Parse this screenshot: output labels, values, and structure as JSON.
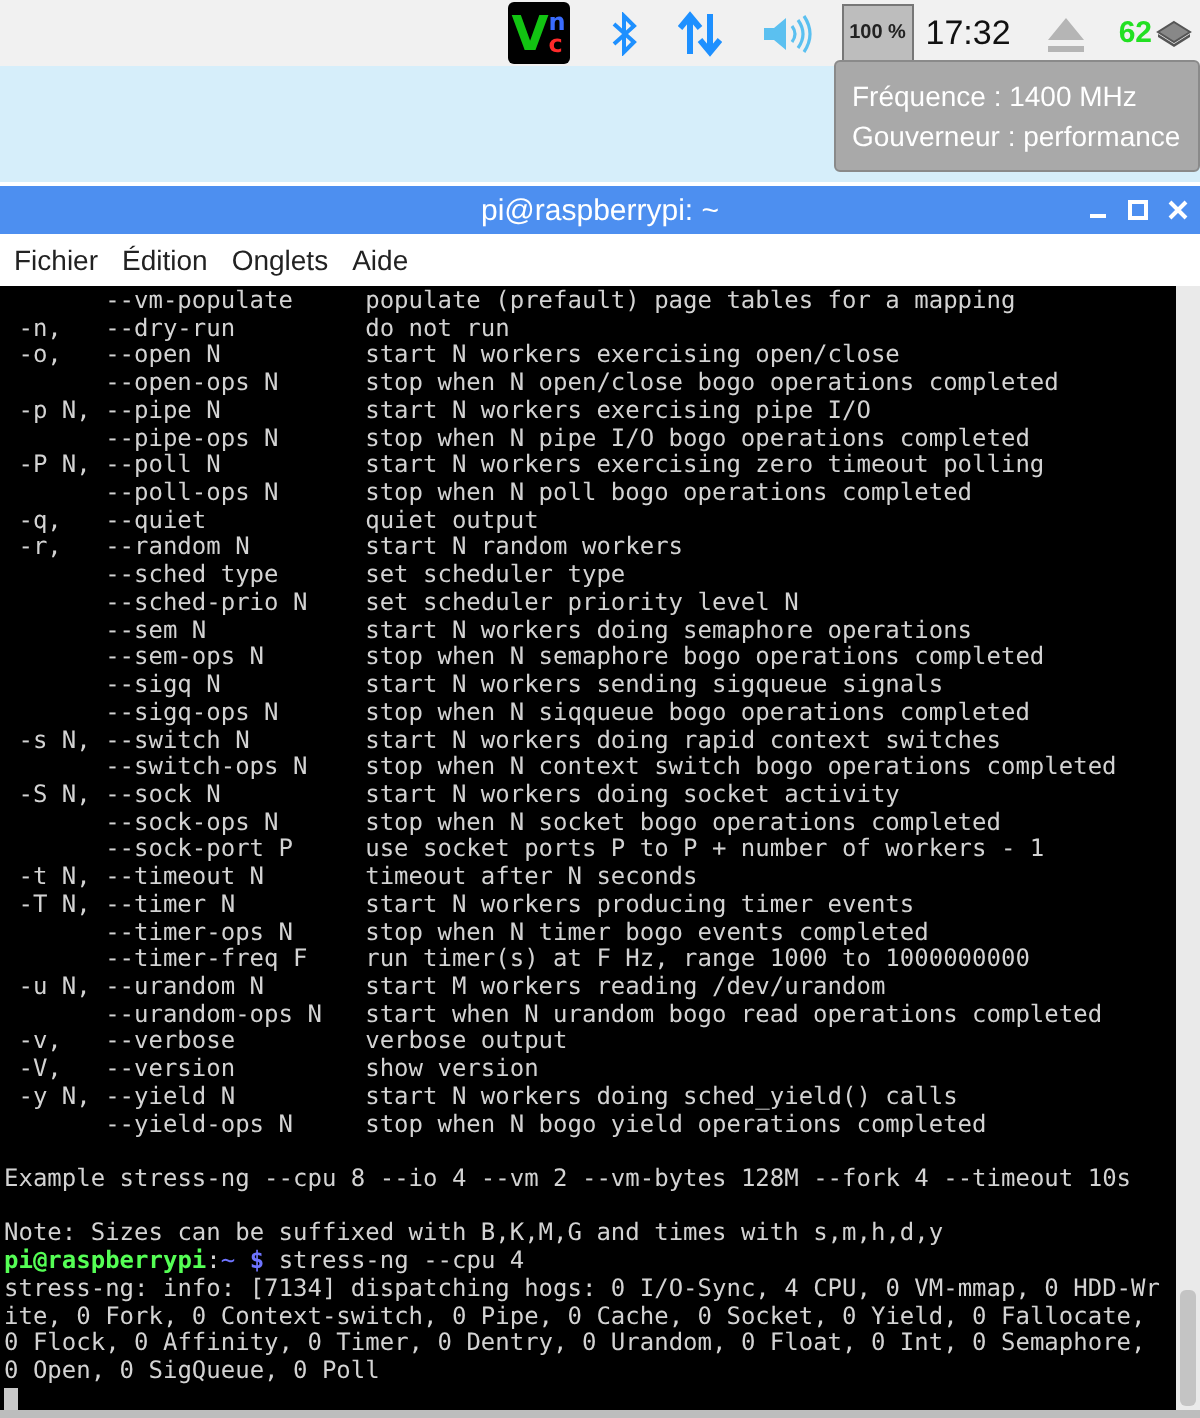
{
  "taskbar": {
    "vnc_logo": [
      "V",
      "n",
      "c"
    ],
    "cpu_monitor": "100 %",
    "clock": "17:32",
    "temperature": "62"
  },
  "tooltip": {
    "lines": [
      "Fréquence : 1400 MHz",
      "Gouverneur : performance"
    ]
  },
  "window": {
    "title": "pi@raspberrypi: ~"
  },
  "menu": [
    "Fichier",
    "Édition",
    "Onglets",
    "Aide"
  ],
  "terminal": {
    "lines": [
      {
        "kind": "option",
        "long": "--vm-populate",
        "desc": "populate (prefault) page tables for a mapping"
      },
      {
        "kind": "option",
        "short": "-n,",
        "long": "--dry-run",
        "desc": "do not run"
      },
      {
        "kind": "option",
        "short": "-o,",
        "long": "--open N",
        "desc": "start N workers exercising open/close"
      },
      {
        "kind": "option",
        "long": "--open-ops N",
        "desc": "stop when N open/close bogo operations completed"
      },
      {
        "kind": "option",
        "short": "-p N,",
        "long": "--pipe N",
        "desc": "start N workers exercising pipe I/O"
      },
      {
        "kind": "option",
        "long": "--pipe-ops N",
        "desc": "stop when N pipe I/O bogo operations completed"
      },
      {
        "kind": "option",
        "short": "-P N,",
        "long": "--poll N",
        "desc": "start N workers exercising zero timeout polling"
      },
      {
        "kind": "option",
        "long": "--poll-ops N",
        "desc": "stop when N poll bogo operations completed"
      },
      {
        "kind": "option",
        "short": "-q,",
        "long": "--quiet",
        "desc": "quiet output"
      },
      {
        "kind": "option",
        "short": "-r,",
        "long": "--random N",
        "desc": "start N random workers"
      },
      {
        "kind": "option",
        "long": "--sched type",
        "desc": "set scheduler type"
      },
      {
        "kind": "option",
        "long": "--sched-prio N",
        "desc": "set scheduler priority level N"
      },
      {
        "kind": "option",
        "long": "--sem N",
        "desc": "start N workers doing semaphore operations"
      },
      {
        "kind": "option",
        "long": "--sem-ops N",
        "desc": "stop when N semaphore bogo operations completed"
      },
      {
        "kind": "option",
        "long": "--sigq N",
        "desc": "start N workers sending sigqueue signals"
      },
      {
        "kind": "option",
        "long": "--sigq-ops N",
        "desc": "stop when N siqqueue bogo operations completed"
      },
      {
        "kind": "option",
        "short": "-s N,",
        "long": "--switch N",
        "desc": "start N workers doing rapid context switches"
      },
      {
        "kind": "option",
        "long": "--switch-ops N",
        "desc": "stop when N context switch bogo operations completed"
      },
      {
        "kind": "option",
        "short": "-S N,",
        "long": "--sock N",
        "desc": "start N workers doing socket activity"
      },
      {
        "kind": "option",
        "long": "--sock-ops N",
        "desc": "stop when N socket bogo operations completed"
      },
      {
        "kind": "option",
        "long": "--sock-port P",
        "desc": "use socket ports P to P + number of workers - 1"
      },
      {
        "kind": "option",
        "short": "-t N,",
        "long": "--timeout N",
        "desc": "timeout after N seconds"
      },
      {
        "kind": "option",
        "short": "-T N,",
        "long": "--timer N",
        "desc": "start N workers producing timer events"
      },
      {
        "kind": "option",
        "long": "--timer-ops N",
        "desc": "stop when N timer bogo events completed"
      },
      {
        "kind": "option",
        "long": "--timer-freq F",
        "desc": "run timer(s) at F Hz, range 1000 to 1000000000"
      },
      {
        "kind": "option",
        "short": "-u N,",
        "long": "--urandom N",
        "desc": "start M workers reading /dev/urandom"
      },
      {
        "kind": "option",
        "long": "--urandom-ops N",
        "desc": "start when N urandom bogo read operations completed"
      },
      {
        "kind": "option",
        "short": "-v,",
        "long": "--verbose",
        "desc": "verbose output"
      },
      {
        "kind": "option",
        "short": "-V,",
        "long": "--version",
        "desc": "show version"
      },
      {
        "kind": "option",
        "short": "-y N,",
        "long": "--yield N",
        "desc": "start N workers doing sched_yield() calls"
      },
      {
        "kind": "option",
        "long": "--yield-ops N",
        "desc": "stop when N bogo yield operations completed"
      },
      {
        "kind": "blank"
      },
      {
        "kind": "text",
        "text": "Example stress-ng --cpu 8 --io 4 --vm 2 --vm-bytes 128M --fork 4 --timeout 10s"
      },
      {
        "kind": "blank"
      },
      {
        "kind": "text",
        "text": "Note: Sizes can be suffixed with B,K,M,G and times with s,m,h,d,y"
      },
      {
        "kind": "prompt",
        "user_host": "pi@raspberrypi",
        "separator": ":",
        "path": "~",
        "symbol": "$",
        "command": "stress-ng --cpu 4"
      },
      {
        "kind": "text",
        "text": "stress-ng: info: [7134] dispatching hogs: 0 I/O-Sync, 4 CPU, 0 VM-mmap, 0 HDD-Wr"
      },
      {
        "kind": "text",
        "text": "ite, 0 Fork, 0 Context-switch, 0 Pipe, 0 Cache, 0 Socket, 0 Yield, 0 Fallocate,"
      },
      {
        "kind": "text",
        "text": "0 Flock, 0 Affinity, 0 Timer, 0 Dentry, 0 Urandom, 0 Float, 0 Int, 0 Semaphore,"
      },
      {
        "kind": "text",
        "text": "0 Open, 0 SigQueue, 0 Poll"
      },
      {
        "kind": "cursor"
      }
    ]
  }
}
